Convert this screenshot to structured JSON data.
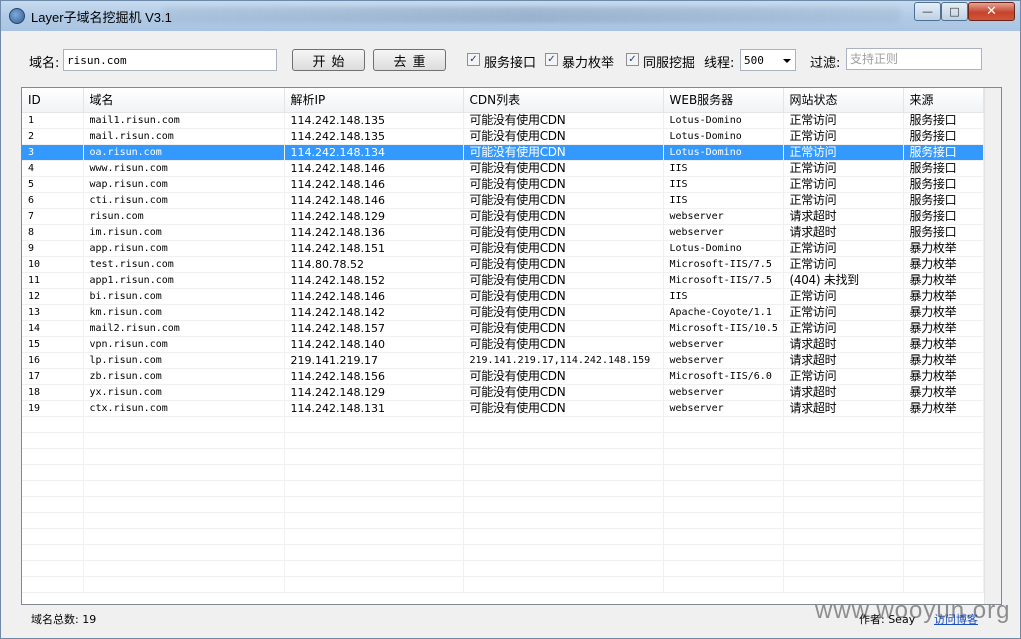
{
  "window": {
    "title": "Layer子域名挖掘机 V3.1",
    "controls": {
      "minimize": "—",
      "maximize": "□",
      "close": "✕"
    }
  },
  "toolbar": {
    "domain_label": "域名:",
    "domain_value": "risun.com",
    "start_label": "开始",
    "dedupe_label": "去重",
    "checkboxes": [
      {
        "label": "服务接口",
        "checked": true
      },
      {
        "label": "暴力枚举",
        "checked": true
      },
      {
        "label": "同服挖掘",
        "checked": true
      }
    ],
    "threads_label": "线程:",
    "threads_value": "500",
    "filter_label": "过滤:",
    "filter_placeholder": "支持正则"
  },
  "table": {
    "columns": [
      "ID",
      "域名",
      "解析IP",
      "CDN列表",
      "WEB服务器",
      "网站状态",
      "来源"
    ],
    "selected_row": 3,
    "rows": [
      [
        "1",
        "mail1.risun.com",
        "114.242.148.135",
        "可能没有使用CDN",
        "Lotus-Domino",
        "正常访问",
        "服务接口"
      ],
      [
        "2",
        "mail.risun.com",
        "114.242.148.135",
        "可能没有使用CDN",
        "Lotus-Domino",
        "正常访问",
        "服务接口"
      ],
      [
        "3",
        "oa.risun.com",
        "114.242.148.134",
        "可能没有使用CDN",
        "Lotus-Domino",
        "正常访问",
        "服务接口"
      ],
      [
        "4",
        "www.risun.com",
        "114.242.148.146",
        "可能没有使用CDN",
        "IIS",
        "正常访问",
        "服务接口"
      ],
      [
        "5",
        "wap.risun.com",
        "114.242.148.146",
        "可能没有使用CDN",
        "IIS",
        "正常访问",
        "服务接口"
      ],
      [
        "6",
        "cti.risun.com",
        "114.242.148.146",
        "可能没有使用CDN",
        "IIS",
        "正常访问",
        "服务接口"
      ],
      [
        "7",
        "risun.com",
        "114.242.148.129",
        "可能没有使用CDN",
        "webserver",
        "请求超时",
        "服务接口"
      ],
      [
        "8",
        "im.risun.com",
        "114.242.148.136",
        "可能没有使用CDN",
        "webserver",
        "请求超时",
        "服务接口"
      ],
      [
        "9",
        "app.risun.com",
        "114.242.148.151",
        "可能没有使用CDN",
        "Lotus-Domino",
        "正常访问",
        "暴力枚举"
      ],
      [
        "10",
        "test.risun.com",
        "114.80.78.52",
        "可能没有使用CDN",
        "Microsoft-IIS/7.5",
        "正常访问",
        "暴力枚举"
      ],
      [
        "11",
        "app1.risun.com",
        "114.242.148.152",
        "可能没有使用CDN",
        "Microsoft-IIS/7.5",
        "(404) 未找到",
        "暴力枚举"
      ],
      [
        "12",
        "bi.risun.com",
        "114.242.148.146",
        "可能没有使用CDN",
        "IIS",
        "正常访问",
        "暴力枚举"
      ],
      [
        "13",
        "km.risun.com",
        "114.242.148.142",
        "可能没有使用CDN",
        "Apache-Coyote/1.1",
        "正常访问",
        "暴力枚举"
      ],
      [
        "14",
        "mail2.risun.com",
        "114.242.148.157",
        "可能没有使用CDN",
        "Microsoft-IIS/10.5",
        "正常访问",
        "暴力枚举"
      ],
      [
        "15",
        "vpn.risun.com",
        "114.242.148.140",
        "可能没有使用CDN",
        "webserver",
        "请求超时",
        "暴力枚举"
      ],
      [
        "16",
        "lp.risun.com",
        "219.141.219.17",
        "219.141.219.17,114.242.148.159",
        "webserver",
        "请求超时",
        "暴力枚举"
      ],
      [
        "17",
        "zb.risun.com",
        "114.242.148.156",
        "可能没有使用CDN",
        "Microsoft-IIS/6.0",
        "正常访问",
        "暴力枚举"
      ],
      [
        "18",
        "yx.risun.com",
        "114.242.148.129",
        "可能没有使用CDN",
        "webserver",
        "请求超时",
        "暴力枚举"
      ],
      [
        "19",
        "ctx.risun.com",
        "114.242.148.131",
        "可能没有使用CDN",
        "webserver",
        "请求超时",
        "暴力枚举"
      ]
    ]
  },
  "statusbar": {
    "total_label": "域名总数: 19",
    "author": "作者: Seay",
    "blog_link": "访问博客"
  },
  "watermark": "www.wooyun.org"
}
